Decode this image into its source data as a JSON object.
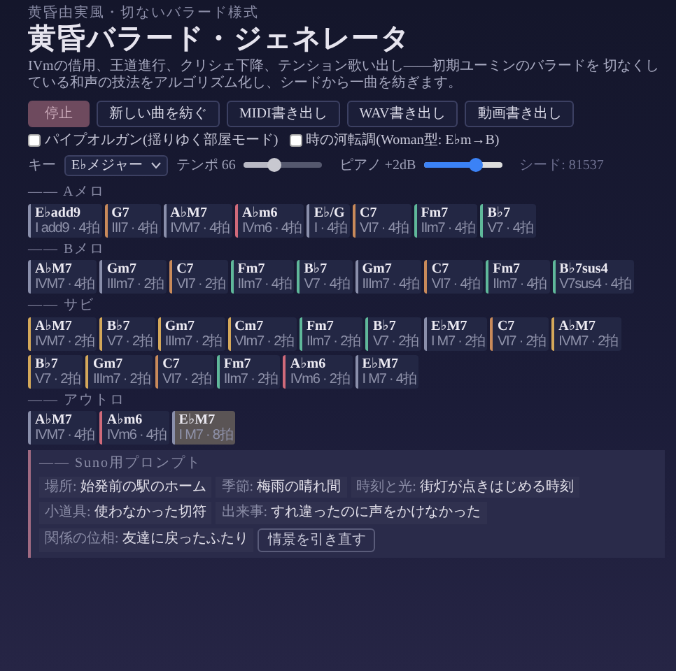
{
  "eyebrow": "黄昏由実風・切ないバラード様式",
  "title": "黄昏バラード・ジェネレータ",
  "description": "IVmの借用、王道進行、クリシェ下降、テンション歌い出し——初期ユーミンのバラードを 切なくしている和声の技法をアルゴリズム化し、シードから一曲を紡ぎます。",
  "buttons": [
    {
      "label": "停止",
      "primary": true
    },
    {
      "label": "新しい曲を紡ぐ",
      "primary": false
    },
    {
      "label": "MIDI書き出し",
      "primary": false
    },
    {
      "label": "WAV書き出し",
      "primary": false
    },
    {
      "label": "動画書き出し",
      "primary": false
    }
  ],
  "options": [
    {
      "label": "パイプオルガン(揺りゆく部屋モード)",
      "checked": false
    },
    {
      "label": "時の河転調(Woman型: E♭m→B)",
      "checked": false
    }
  ],
  "controls": {
    "key_label": "キー",
    "key_value": "E♭メジャー",
    "tempo_label": "テンポ 66",
    "tempo": {
      "level": 0.38
    },
    "piano_label": "ピアノ +2dB",
    "piano": {
      "level": 0.65
    },
    "seed": "シード: 81537"
  },
  "sections": [
    {
      "label": "—— Aメロ",
      "chords": [
        {
          "name": "E♭add9",
          "degree": "I add9 · 4拍",
          "color": "#8a8fab",
          "playing": false
        },
        {
          "name": "G7",
          "degree": "III7 · 4拍",
          "color": "#c98a5a",
          "playing": false
        },
        {
          "name": "A♭M7",
          "degree": "IVM7 · 4拍",
          "color": "#8a8fab",
          "playing": false
        },
        {
          "name": "A♭m6",
          "degree": "IVm6 · 4拍",
          "color": "#d06a7a",
          "playing": false
        },
        {
          "name": "E♭/G",
          "degree": "I · 4拍",
          "color": "#8a8fab",
          "playing": false
        },
        {
          "name": "C7",
          "degree": "VI7 · 4拍",
          "color": "#c98a5a",
          "playing": false
        },
        {
          "name": "Fm7",
          "degree": "IIm7 · 4拍",
          "color": "#5fb89a",
          "playing": false
        },
        {
          "name": "B♭7",
          "degree": "V7 · 4拍",
          "color": "#5fb89a",
          "playing": false
        }
      ]
    },
    {
      "label": "—— Bメロ",
      "chords": [
        {
          "name": "A♭M7",
          "degree": "IVM7 · 4拍",
          "color": "#8a8fab",
          "playing": false
        },
        {
          "name": "Gm7",
          "degree": "IIIm7 · 2拍",
          "color": "#8a8fab",
          "playing": false
        },
        {
          "name": "C7",
          "degree": "VI7 · 2拍",
          "color": "#c98a5a",
          "playing": false
        },
        {
          "name": "Fm7",
          "degree": "IIm7 · 4拍",
          "color": "#5fb89a",
          "playing": false
        },
        {
          "name": "B♭7",
          "degree": "V7 · 4拍",
          "color": "#5fb89a",
          "playing": false
        },
        {
          "name": "Gm7",
          "degree": "IIIm7 · 4拍",
          "color": "#8a8fab",
          "playing": false
        },
        {
          "name": "C7",
          "degree": "VI7 · 4拍",
          "color": "#c98a5a",
          "playing": false
        },
        {
          "name": "Fm7",
          "degree": "IIm7 · 4拍",
          "color": "#5fb89a",
          "playing": false
        },
        {
          "name": "B♭7sus4",
          "degree": "V7sus4 · 4拍",
          "color": "#5fb89a",
          "playing": false
        }
      ]
    },
    {
      "label": "—— サビ",
      "chords": [
        {
          "name": "A♭M7",
          "degree": "IVM7 · 2拍",
          "color": "#d4a85a",
          "playing": false
        },
        {
          "name": "B♭7",
          "degree": "V7 · 2拍",
          "color": "#d4a85a",
          "playing": false
        },
        {
          "name": "Gm7",
          "degree": "IIIm7 · 2拍",
          "color": "#d4a85a",
          "playing": false
        },
        {
          "name": "Cm7",
          "degree": "VIm7 · 2拍",
          "color": "#d4a85a",
          "playing": false
        },
        {
          "name": "Fm7",
          "degree": "IIm7 · 2拍",
          "color": "#5fb89a",
          "playing": false
        },
        {
          "name": "B♭7",
          "degree": "V7 · 2拍",
          "color": "#5fb89a",
          "playing": false
        },
        {
          "name": "E♭M7",
          "degree": "I M7 · 2拍",
          "color": "#8a8fab",
          "playing": false
        },
        {
          "name": "C7",
          "degree": "VI7 · 2拍",
          "color": "#c98a5a",
          "playing": false
        },
        {
          "name": "A♭M7",
          "degree": "IVM7 · 2拍",
          "color": "#d4a85a",
          "playing": false
        },
        {
          "name": "B♭7",
          "degree": "V7 · 2拍",
          "color": "#d4a85a",
          "playing": false
        },
        {
          "name": "Gm7",
          "degree": "IIIm7 · 2拍",
          "color": "#d4a85a",
          "playing": false
        },
        {
          "name": "C7",
          "degree": "VI7 · 2拍",
          "color": "#c98a5a",
          "playing": false
        },
        {
          "name": "Fm7",
          "degree": "IIm7 · 2拍",
          "color": "#5fb89a",
          "playing": false
        },
        {
          "name": "A♭m6",
          "degree": "IVm6 · 2拍",
          "color": "#d06a7a",
          "playing": false
        },
        {
          "name": "E♭M7",
          "degree": "I M7 · 4拍",
          "color": "#8a8fab",
          "playing": false
        }
      ]
    },
    {
      "label": "—— アウトロ",
      "chords": [
        {
          "name": "A♭M7",
          "degree": "IVM7 · 4拍",
          "color": "#8a8fab",
          "playing": false
        },
        {
          "name": "A♭m6",
          "degree": "IVm6 · 4拍",
          "color": "#d06a7a",
          "playing": false
        },
        {
          "name": "E♭M7",
          "degree": "I M7 · 8拍",
          "color": "#8a8fab",
          "playing": true
        }
      ]
    }
  ],
  "prompt": {
    "title": "—— Suno用プロンプト",
    "chips": [
      {
        "label": "場所:",
        "value": "始発前の駅のホーム"
      },
      {
        "label": "季節:",
        "value": "梅雨の晴れ間"
      },
      {
        "label": "時刻と光:",
        "value": "街灯が点きはじめる時刻"
      },
      {
        "label": "小道具:",
        "value": "使わなかった切符"
      },
      {
        "label": "出来事:",
        "value": "すれ違ったのに声をかけなかった"
      },
      {
        "label": "関係の位相:",
        "value": "友達に戻ったふたり"
      }
    ],
    "reroll": "情景を引き直す"
  }
}
